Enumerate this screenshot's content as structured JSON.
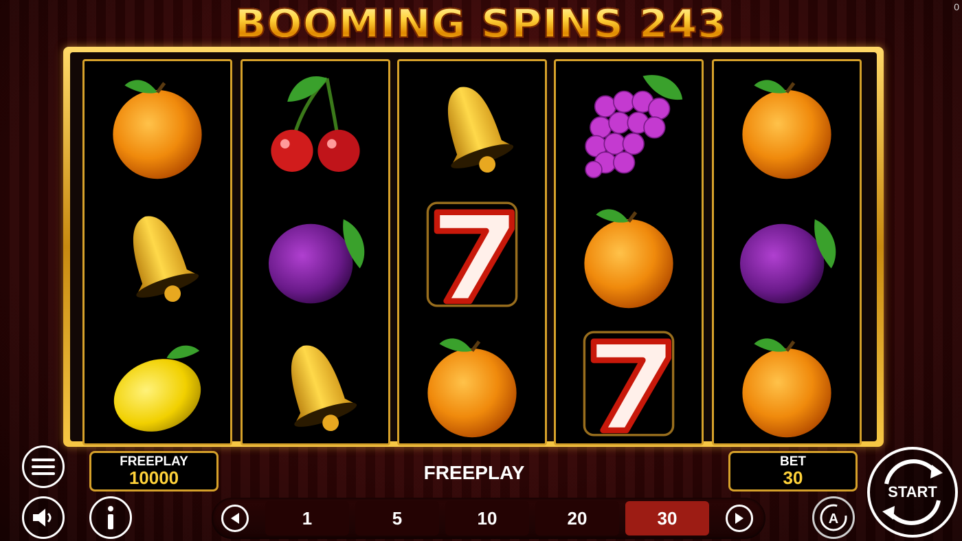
{
  "game": {
    "title": "BOOMING SPINS 243",
    "corner_value": "0"
  },
  "reels": [
    [
      "orange-icon",
      "bell-icon",
      "lemon-icon"
    ],
    [
      "cherry-icon",
      "plum-icon",
      "bell-icon"
    ],
    [
      "bell-icon",
      "seven-icon",
      "orange-icon"
    ],
    [
      "grapes-icon",
      "orange-icon",
      "seven-icon"
    ],
    [
      "orange-icon",
      "plum-icon",
      "orange-icon"
    ]
  ],
  "balance": {
    "label": "FREEPLAY",
    "value": "10000"
  },
  "status_text": "FREEPLAY",
  "bet": {
    "label": "BET",
    "value": "30"
  },
  "bet_options": [
    "1",
    "5",
    "10",
    "20",
    "30"
  ],
  "selected_bet": "30",
  "start_label": "START",
  "colors": {
    "gold": "#d6a12a",
    "selected_bet": "#9d1c14",
    "value_yellow": "#ffd23a"
  }
}
